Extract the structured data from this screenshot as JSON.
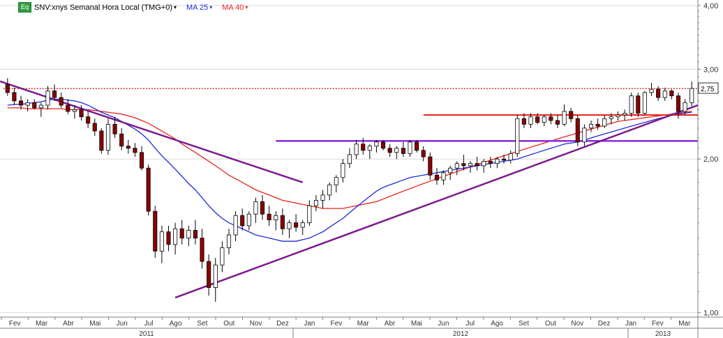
{
  "legend": {
    "badge": "Eq",
    "symbol": "SNV:xnys Semanal Hora Local (TMG+0)",
    "ma25_label": "MA 25",
    "ma40_label": "MA 40",
    "caret_icon": "▾"
  },
  "colors": {
    "background": "#ffffff",
    "grid": "#d9d9d9",
    "ma25": "#1f2bd6",
    "ma40": "#e8231b",
    "trendline": "#7b1a8c",
    "resistance_red": "#e8231b",
    "resistance_purple": "#8a2be2",
    "reference": "#c80000",
    "candle_up": "#ffffff",
    "candle_down": "#8b0000",
    "axis": "#7f7f7f"
  },
  "chart_data": {
    "type": "candlestick",
    "yscale": "log",
    "ylim": [
      0.98,
      4.1
    ],
    "y_ticks": [
      "4,00",
      "3,00",
      "2,00",
      "1,00"
    ],
    "y_tick_values": [
      4.0,
      3.0,
      2.0,
      1.0
    ],
    "last_price_label": "2,75",
    "last_price": 2.75,
    "months": [
      "Fev",
      "Mar",
      "Abr",
      "Mai",
      "Jun",
      "Jul",
      "Ago",
      "Set",
      "Out",
      "Nov",
      "Dez",
      "Jan",
      "Fev",
      "Mar",
      "Abr",
      "Mai",
      "Jun",
      "Jul",
      "Ago",
      "Set",
      "Out",
      "Nov",
      "Dez",
      "Jan",
      "Fev",
      "Mar"
    ],
    "years": [
      "2011",
      "2012",
      "2013"
    ],
    "candles_ohlc": [
      [
        2.8,
        2.88,
        2.66,
        2.7
      ],
      [
        2.7,
        2.76,
        2.55,
        2.6
      ],
      [
        2.6,
        2.66,
        2.5,
        2.55
      ],
      [
        2.55,
        2.62,
        2.48,
        2.58
      ],
      [
        2.58,
        2.62,
        2.5,
        2.52
      ],
      [
        2.52,
        2.58,
        2.42,
        2.55
      ],
      [
        2.55,
        2.78,
        2.5,
        2.72
      ],
      [
        2.72,
        2.8,
        2.6,
        2.64
      ],
      [
        2.64,
        2.7,
        2.52,
        2.55
      ],
      [
        2.55,
        2.62,
        2.45,
        2.48
      ],
      [
        2.48,
        2.55,
        2.4,
        2.5
      ],
      [
        2.5,
        2.55,
        2.38,
        2.42
      ],
      [
        2.42,
        2.48,
        2.3,
        2.35
      ],
      [
        2.35,
        2.4,
        2.22,
        2.27
      ],
      [
        2.27,
        2.3,
        2.05,
        2.08
      ],
      [
        2.08,
        2.4,
        2.04,
        2.34
      ],
      [
        2.34,
        2.42,
        2.2,
        2.24
      ],
      [
        2.24,
        2.3,
        2.08,
        2.12
      ],
      [
        2.12,
        2.18,
        2.05,
        2.1
      ],
      [
        2.1,
        2.15,
        2.02,
        2.06
      ],
      [
        2.06,
        2.12,
        1.9,
        1.92
      ],
      [
        1.92,
        1.95,
        1.55,
        1.58
      ],
      [
        1.58,
        1.62,
        1.28,
        1.32
      ],
      [
        1.32,
        1.48,
        1.25,
        1.44
      ],
      [
        1.44,
        1.48,
        1.32,
        1.36
      ],
      [
        1.36,
        1.5,
        1.3,
        1.46
      ],
      [
        1.46,
        1.52,
        1.36,
        1.4
      ],
      [
        1.4,
        1.48,
        1.35,
        1.45
      ],
      [
        1.45,
        1.52,
        1.36,
        1.4
      ],
      [
        1.4,
        1.46,
        1.22,
        1.26
      ],
      [
        1.26,
        1.3,
        1.08,
        1.12
      ],
      [
        1.12,
        1.28,
        1.05,
        1.24
      ],
      [
        1.24,
        1.38,
        1.2,
        1.34
      ],
      [
        1.34,
        1.46,
        1.3,
        1.42
      ],
      [
        1.42,
        1.58,
        1.38,
        1.55
      ],
      [
        1.55,
        1.6,
        1.45,
        1.48
      ],
      [
        1.48,
        1.58,
        1.45,
        1.56
      ],
      [
        1.56,
        1.68,
        1.5,
        1.65
      ],
      [
        1.65,
        1.7,
        1.52,
        1.56
      ],
      [
        1.56,
        1.62,
        1.48,
        1.52
      ],
      [
        1.52,
        1.58,
        1.45,
        1.55
      ],
      [
        1.55,
        1.6,
        1.42,
        1.46
      ],
      [
        1.46,
        1.52,
        1.4,
        1.5
      ],
      [
        1.5,
        1.56,
        1.44,
        1.47
      ],
      [
        1.47,
        1.52,
        1.42,
        1.5
      ],
      [
        1.5,
        1.66,
        1.48,
        1.62
      ],
      [
        1.62,
        1.7,
        1.58,
        1.66
      ],
      [
        1.66,
        1.74,
        1.6,
        1.7
      ],
      [
        1.7,
        1.8,
        1.66,
        1.78
      ],
      [
        1.78,
        1.86,
        1.72,
        1.84
      ],
      [
        1.84,
        2.0,
        1.8,
        1.96
      ],
      [
        1.96,
        2.1,
        1.92,
        2.04
      ],
      [
        2.04,
        2.18,
        2.0,
        2.14
      ],
      [
        2.14,
        2.2,
        2.04,
        2.08
      ],
      [
        2.08,
        2.14,
        2.0,
        2.12
      ],
      [
        2.12,
        2.18,
        2.06,
        2.16
      ],
      [
        2.16,
        2.18,
        2.08,
        2.1
      ],
      [
        2.1,
        2.14,
        2.02,
        2.06
      ],
      [
        2.06,
        2.12,
        2.0,
        2.1
      ],
      [
        2.1,
        2.16,
        2.02,
        2.05
      ],
      [
        2.05,
        2.18,
        2.02,
        2.16
      ],
      [
        2.16,
        2.18,
        2.06,
        2.08
      ],
      [
        2.08,
        2.12,
        1.98,
        2.02
      ],
      [
        2.02,
        2.06,
        1.82,
        1.86
      ],
      [
        1.86,
        1.92,
        1.78,
        1.82
      ],
      [
        1.82,
        1.9,
        1.78,
        1.88
      ],
      [
        1.88,
        1.94,
        1.82,
        1.92
      ],
      [
        1.92,
        1.98,
        1.86,
        1.96
      ],
      [
        1.96,
        2.04,
        1.9,
        1.94
      ],
      [
        1.94,
        1.98,
        1.88,
        1.96
      ],
      [
        1.96,
        2.02,
        1.9,
        1.94
      ],
      [
        1.94,
        2.0,
        1.88,
        1.98
      ],
      [
        1.98,
        2.02,
        1.92,
        1.96
      ],
      [
        1.96,
        2.02,
        1.92,
        2.0
      ],
      [
        2.0,
        2.04,
        1.96,
        1.99
      ],
      [
        1.99,
        2.08,
        1.96,
        2.05
      ],
      [
        2.05,
        2.44,
        2.02,
        2.4
      ],
      [
        2.4,
        2.46,
        2.3,
        2.34
      ],
      [
        2.34,
        2.46,
        2.3,
        2.42
      ],
      [
        2.42,
        2.46,
        2.34,
        2.36
      ],
      [
        2.36,
        2.44,
        2.32,
        2.42
      ],
      [
        2.42,
        2.46,
        2.34,
        2.38
      ],
      [
        2.38,
        2.44,
        2.3,
        2.34
      ],
      [
        2.34,
        2.56,
        2.32,
        2.48
      ],
      [
        2.48,
        2.52,
        2.36,
        2.4
      ],
      [
        2.4,
        2.44,
        2.12,
        2.16
      ],
      [
        2.16,
        2.34,
        2.12,
        2.3
      ],
      [
        2.3,
        2.38,
        2.26,
        2.34
      ],
      [
        2.34,
        2.4,
        2.28,
        2.32
      ],
      [
        2.32,
        2.44,
        2.3,
        2.4
      ],
      [
        2.4,
        2.46,
        2.34,
        2.42
      ],
      [
        2.42,
        2.48,
        2.38,
        2.44
      ],
      [
        2.44,
        2.5,
        2.38,
        2.46
      ],
      [
        2.46,
        2.7,
        2.42,
        2.66
      ],
      [
        2.66,
        2.7,
        2.42,
        2.46
      ],
      [
        2.46,
        2.72,
        2.44,
        2.7
      ],
      [
        2.7,
        2.82,
        2.66,
        2.74
      ],
      [
        2.74,
        2.78,
        2.6,
        2.64
      ],
      [
        2.64,
        2.76,
        2.6,
        2.72
      ],
      [
        2.72,
        2.74,
        2.62,
        2.66
      ],
      [
        2.66,
        2.7,
        2.4,
        2.48
      ],
      [
        2.48,
        2.62,
        2.44,
        2.58
      ],
      [
        2.58,
        2.84,
        2.54,
        2.75
      ]
    ],
    "ma25": [
      2.55,
      2.56,
      2.56,
      2.57,
      2.58,
      2.59,
      2.61,
      2.62,
      2.62,
      2.61,
      2.6,
      2.58,
      2.55,
      2.51,
      2.47,
      2.44,
      2.41,
      2.37,
      2.33,
      2.29,
      2.24,
      2.18,
      2.1,
      2.03,
      1.97,
      1.91,
      1.85,
      1.79,
      1.74,
      1.68,
      1.62,
      1.57,
      1.53,
      1.5,
      1.48,
      1.46,
      1.44,
      1.42,
      1.41,
      1.4,
      1.39,
      1.38,
      1.38,
      1.38,
      1.39,
      1.4,
      1.42,
      1.44,
      1.47,
      1.5,
      1.53,
      1.57,
      1.61,
      1.65,
      1.69,
      1.73,
      1.76,
      1.78,
      1.8,
      1.82,
      1.84,
      1.85,
      1.86,
      1.87,
      1.88,
      1.89,
      1.9,
      1.91,
      1.92,
      1.93,
      1.94,
      1.95,
      1.96,
      1.97,
      1.98,
      1.99,
      2.0,
      2.02,
      2.04,
      2.06,
      2.08,
      2.1,
      2.12,
      2.14,
      2.15,
      2.16,
      2.18,
      2.2,
      2.22,
      2.24,
      2.26,
      2.28,
      2.3,
      2.32,
      2.34,
      2.36,
      2.38,
      2.4,
      2.42,
      2.44,
      2.45,
      2.46,
      2.47
    ],
    "ma40": [
      2.52,
      2.52,
      2.52,
      2.51,
      2.51,
      2.51,
      2.51,
      2.51,
      2.51,
      2.5,
      2.5,
      2.5,
      2.5,
      2.49,
      2.48,
      2.47,
      2.46,
      2.45,
      2.43,
      2.41,
      2.38,
      2.35,
      2.31,
      2.27,
      2.23,
      2.19,
      2.14,
      2.1,
      2.06,
      2.02,
      1.98,
      1.94,
      1.9,
      1.86,
      1.83,
      1.8,
      1.77,
      1.74,
      1.72,
      1.7,
      1.68,
      1.66,
      1.65,
      1.64,
      1.63,
      1.62,
      1.61,
      1.6,
      1.6,
      1.6,
      1.6,
      1.61,
      1.62,
      1.63,
      1.64,
      1.65,
      1.67,
      1.69,
      1.71,
      1.73,
      1.75,
      1.77,
      1.79,
      1.81,
      1.83,
      1.85,
      1.87,
      1.89,
      1.91,
      1.93,
      1.95,
      1.97,
      1.99,
      2.01,
      2.03,
      2.05,
      2.07,
      2.09,
      2.11,
      2.13,
      2.15,
      2.17,
      2.19,
      2.21,
      2.23,
      2.25,
      2.27,
      2.29,
      2.31,
      2.33,
      2.35,
      2.37,
      2.38,
      2.39,
      2.4,
      2.41,
      2.42,
      2.43,
      2.44,
      2.45,
      2.46,
      2.47,
      2.48
    ],
    "lines": {
      "downtrend": [
        [
          0,
          2.84
        ],
        [
          44,
          1.8
        ]
      ],
      "uptrend": [
        [
          25,
          1.07
        ],
        [
          103,
          2.55
        ]
      ],
      "red_resistance": [
        [
          62,
          2.44
        ],
        [
          103,
          2.44
        ]
      ],
      "purple_resistance": [
        [
          40,
          2.17
        ],
        [
          103,
          2.17
        ]
      ],
      "dotted_reference": [
        [
          0,
          2.75
        ],
        [
          103,
          2.75
        ]
      ]
    }
  }
}
